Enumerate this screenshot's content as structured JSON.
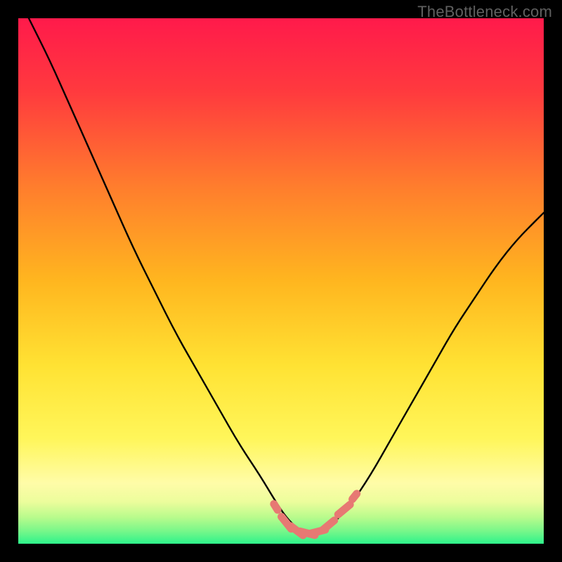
{
  "watermark": {
    "text": "TheBottleneck.com"
  },
  "colors": {
    "black": "#000000",
    "grad_top": "#ff1a4b",
    "grad_mid1": "#ff6a2f",
    "grad_mid2": "#ffbe1c",
    "grad_mid3": "#ffe83e",
    "grad_yellow": "#fff996",
    "grad_lime": "#c7f97a",
    "grad_green": "#35f48b",
    "curve": "#000000",
    "marker": "#e77973"
  },
  "chart_data": {
    "type": "line",
    "title": "",
    "xlabel": "",
    "ylabel": "",
    "xlim": [
      0,
      100
    ],
    "ylim": [
      0,
      100
    ],
    "grid": false,
    "series": [
      {
        "name": "bottleneck-curve",
        "x": [
          2,
          6,
          10,
          14,
          18,
          22,
          26,
          30,
          34,
          38,
          42,
          46,
          49,
          51,
          53,
          55,
          57,
          59,
          63,
          67,
          71,
          75,
          79,
          83,
          87,
          91,
          95,
          99,
          100
        ],
        "values": [
          100,
          92,
          83,
          74,
          65,
          56,
          48,
          40,
          33,
          26,
          19,
          13,
          8,
          5,
          3,
          2,
          2,
          3,
          7,
          13,
          20,
          27,
          34,
          41,
          47,
          53,
          58,
          62,
          63
        ]
      }
    ],
    "markers": [
      {
        "name": "flat-segment-left-edge",
        "x": 49,
        "y": 7
      },
      {
        "name": "flat-segment-left-mid",
        "x": 51,
        "y": 4
      },
      {
        "name": "flat-segment-center-left",
        "x": 53,
        "y": 2.5
      },
      {
        "name": "flat-segment-center",
        "x": 55,
        "y": 2
      },
      {
        "name": "flat-segment-center-right",
        "x": 57,
        "y": 2.3
      },
      {
        "name": "flat-segment-right-mid",
        "x": 59,
        "y": 3.5
      },
      {
        "name": "flat-segment-right-edge",
        "x": 62,
        "y": 6.5
      },
      {
        "name": "flat-segment-far-right",
        "x": 64,
        "y": 9
      }
    ]
  }
}
